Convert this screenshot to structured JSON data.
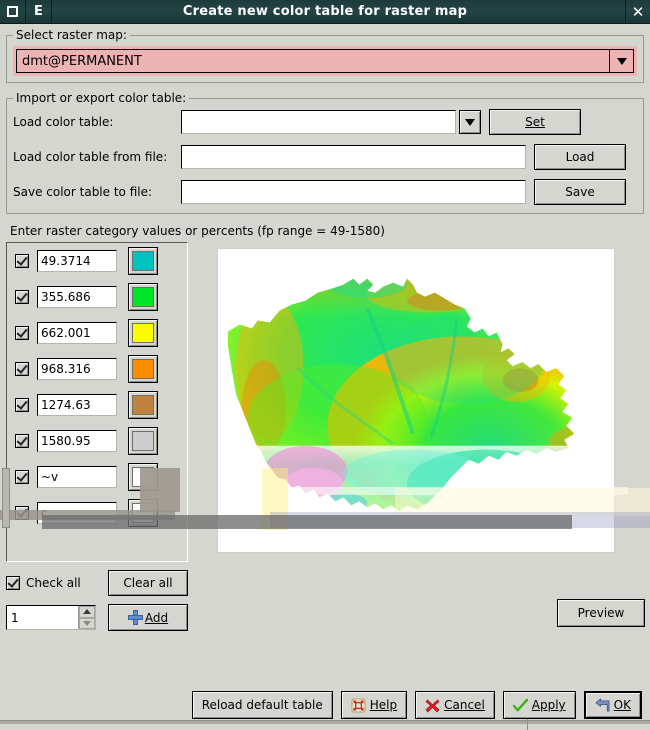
{
  "window": {
    "title": "Create new color table for raster map",
    "icon_menu": "window-menu-icon",
    "icon_app": "E",
    "close_label": "✕"
  },
  "raster_select": {
    "legend": "Select raster map:",
    "value": "dmt@PERMANENT",
    "arrow": "▼",
    "bg_color": "#eeb3b3"
  },
  "import_export": {
    "legend": "Import or export color table:",
    "rows": [
      {
        "label": "Load color table:",
        "value": "",
        "button": "Set",
        "has_dropdown": true
      },
      {
        "label": "Load color table from file:",
        "value": "",
        "button": "Load",
        "has_dropdown": false
      },
      {
        "label": "Save color table to file:",
        "value": "",
        "button": "Save",
        "has_dropdown": false
      }
    ]
  },
  "categories": {
    "caption": "Enter raster category values or percents (fp range = 49-1580)",
    "rows": [
      {
        "checked": true,
        "value": "49.3714",
        "color": "#00c3c0"
      },
      {
        "checked": true,
        "value": "355.686",
        "color": "#00e527"
      },
      {
        "checked": true,
        "value": "662.001",
        "color": "#fcfc00"
      },
      {
        "checked": true,
        "value": "968.316",
        "color": "#fc8c00"
      },
      {
        "checked": true,
        "value": "1274.63",
        "color": "#c0823f"
      },
      {
        "checked": true,
        "value": "1580.95",
        "color": "#cdcdcd"
      },
      {
        "checked": true,
        "value": "~v",
        "color": "#ffffff"
      },
      {
        "checked": true,
        "value": "c .",
        "color": "#ffffff"
      }
    ]
  },
  "left_controls": {
    "check_all_label": "Check all",
    "check_all_checked": true,
    "clear_all_label": "Clear all",
    "spin_value": "1",
    "add_label": "Add",
    "add_icon": "plus-icon"
  },
  "preview": {
    "button_label": "Preview"
  },
  "footer": {
    "buttons": [
      {
        "label": "Reload default table",
        "icon": null,
        "default": false
      },
      {
        "label": "Help",
        "icon": "help-icon",
        "default": false
      },
      {
        "label": "Cancel",
        "icon": "cancel-icon",
        "default": false
      },
      {
        "label": "Apply",
        "icon": "apply-icon",
        "default": false
      },
      {
        "label": "OK",
        "icon": "ok-icon",
        "default": true
      }
    ]
  },
  "map": {
    "alt": "Czech Republic digital elevation model preview",
    "background": "#ffffff"
  }
}
